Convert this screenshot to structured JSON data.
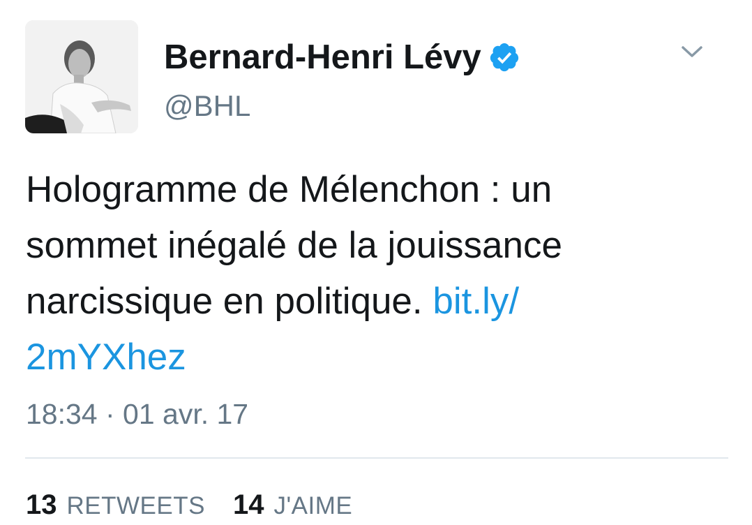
{
  "tweet": {
    "author": {
      "display_name": "Bernard-Henri Lévy",
      "handle": "@BHL",
      "verified": true,
      "avatar_icon": "profile-photo-grayscale"
    },
    "text_line1": "Hologramme de Mélenchon : un",
    "text_line2": "sommet inégalé de la jouissance",
    "text_line3": "narcissique en politique.",
    "link_part1": "bit.ly/",
    "link_part2": "2mYXhez",
    "timestamp": "18:34 · 01 avr. 17",
    "stats": {
      "retweets_count": "13",
      "retweets_label": "RETWEETS",
      "likes_count": "14",
      "likes_label": "J'AIME"
    }
  },
  "colors": {
    "link": "#1b95e0",
    "secondary_text": "#657786",
    "verified_badge": "#1da1f2",
    "divider": "#e1e8ed"
  },
  "icons": {
    "verified": "verified-badge-icon",
    "menu": "chevron-down-icon"
  }
}
